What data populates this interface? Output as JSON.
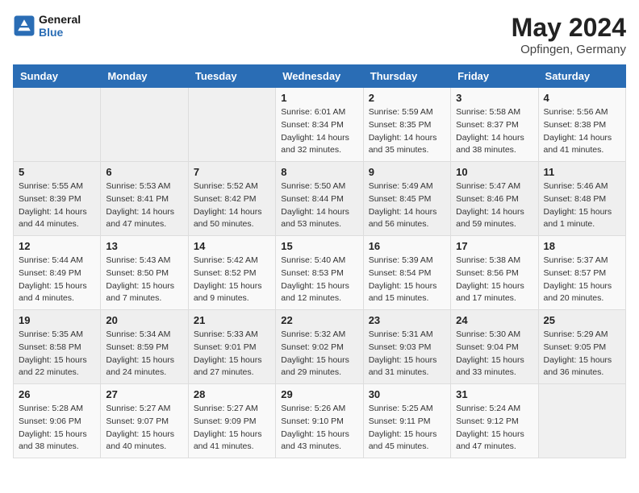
{
  "header": {
    "logo_line1": "General",
    "logo_line2": "Blue",
    "month": "May 2024",
    "location": "Opfingen, Germany"
  },
  "columns": [
    "Sunday",
    "Monday",
    "Tuesday",
    "Wednesday",
    "Thursday",
    "Friday",
    "Saturday"
  ],
  "weeks": [
    [
      {
        "num": "",
        "info": ""
      },
      {
        "num": "",
        "info": ""
      },
      {
        "num": "",
        "info": ""
      },
      {
        "num": "1",
        "info": "Sunrise: 6:01 AM\nSunset: 8:34 PM\nDaylight: 14 hours\nand 32 minutes."
      },
      {
        "num": "2",
        "info": "Sunrise: 5:59 AM\nSunset: 8:35 PM\nDaylight: 14 hours\nand 35 minutes."
      },
      {
        "num": "3",
        "info": "Sunrise: 5:58 AM\nSunset: 8:37 PM\nDaylight: 14 hours\nand 38 minutes."
      },
      {
        "num": "4",
        "info": "Sunrise: 5:56 AM\nSunset: 8:38 PM\nDaylight: 14 hours\nand 41 minutes."
      }
    ],
    [
      {
        "num": "5",
        "info": "Sunrise: 5:55 AM\nSunset: 8:39 PM\nDaylight: 14 hours\nand 44 minutes."
      },
      {
        "num": "6",
        "info": "Sunrise: 5:53 AM\nSunset: 8:41 PM\nDaylight: 14 hours\nand 47 minutes."
      },
      {
        "num": "7",
        "info": "Sunrise: 5:52 AM\nSunset: 8:42 PM\nDaylight: 14 hours\nand 50 minutes."
      },
      {
        "num": "8",
        "info": "Sunrise: 5:50 AM\nSunset: 8:44 PM\nDaylight: 14 hours\nand 53 minutes."
      },
      {
        "num": "9",
        "info": "Sunrise: 5:49 AM\nSunset: 8:45 PM\nDaylight: 14 hours\nand 56 minutes."
      },
      {
        "num": "10",
        "info": "Sunrise: 5:47 AM\nSunset: 8:46 PM\nDaylight: 14 hours\nand 59 minutes."
      },
      {
        "num": "11",
        "info": "Sunrise: 5:46 AM\nSunset: 8:48 PM\nDaylight: 15 hours\nand 1 minute."
      }
    ],
    [
      {
        "num": "12",
        "info": "Sunrise: 5:44 AM\nSunset: 8:49 PM\nDaylight: 15 hours\nand 4 minutes."
      },
      {
        "num": "13",
        "info": "Sunrise: 5:43 AM\nSunset: 8:50 PM\nDaylight: 15 hours\nand 7 minutes."
      },
      {
        "num": "14",
        "info": "Sunrise: 5:42 AM\nSunset: 8:52 PM\nDaylight: 15 hours\nand 9 minutes."
      },
      {
        "num": "15",
        "info": "Sunrise: 5:40 AM\nSunset: 8:53 PM\nDaylight: 15 hours\nand 12 minutes."
      },
      {
        "num": "16",
        "info": "Sunrise: 5:39 AM\nSunset: 8:54 PM\nDaylight: 15 hours\nand 15 minutes."
      },
      {
        "num": "17",
        "info": "Sunrise: 5:38 AM\nSunset: 8:56 PM\nDaylight: 15 hours\nand 17 minutes."
      },
      {
        "num": "18",
        "info": "Sunrise: 5:37 AM\nSunset: 8:57 PM\nDaylight: 15 hours\nand 20 minutes."
      }
    ],
    [
      {
        "num": "19",
        "info": "Sunrise: 5:35 AM\nSunset: 8:58 PM\nDaylight: 15 hours\nand 22 minutes."
      },
      {
        "num": "20",
        "info": "Sunrise: 5:34 AM\nSunset: 8:59 PM\nDaylight: 15 hours\nand 24 minutes."
      },
      {
        "num": "21",
        "info": "Sunrise: 5:33 AM\nSunset: 9:01 PM\nDaylight: 15 hours\nand 27 minutes."
      },
      {
        "num": "22",
        "info": "Sunrise: 5:32 AM\nSunset: 9:02 PM\nDaylight: 15 hours\nand 29 minutes."
      },
      {
        "num": "23",
        "info": "Sunrise: 5:31 AM\nSunset: 9:03 PM\nDaylight: 15 hours\nand 31 minutes."
      },
      {
        "num": "24",
        "info": "Sunrise: 5:30 AM\nSunset: 9:04 PM\nDaylight: 15 hours\nand 33 minutes."
      },
      {
        "num": "25",
        "info": "Sunrise: 5:29 AM\nSunset: 9:05 PM\nDaylight: 15 hours\nand 36 minutes."
      }
    ],
    [
      {
        "num": "26",
        "info": "Sunrise: 5:28 AM\nSunset: 9:06 PM\nDaylight: 15 hours\nand 38 minutes."
      },
      {
        "num": "27",
        "info": "Sunrise: 5:27 AM\nSunset: 9:07 PM\nDaylight: 15 hours\nand 40 minutes."
      },
      {
        "num": "28",
        "info": "Sunrise: 5:27 AM\nSunset: 9:09 PM\nDaylight: 15 hours\nand 41 minutes."
      },
      {
        "num": "29",
        "info": "Sunrise: 5:26 AM\nSunset: 9:10 PM\nDaylight: 15 hours\nand 43 minutes."
      },
      {
        "num": "30",
        "info": "Sunrise: 5:25 AM\nSunset: 9:11 PM\nDaylight: 15 hours\nand 45 minutes."
      },
      {
        "num": "31",
        "info": "Sunrise: 5:24 AM\nSunset: 9:12 PM\nDaylight: 15 hours\nand 47 minutes."
      },
      {
        "num": "",
        "info": ""
      }
    ]
  ]
}
